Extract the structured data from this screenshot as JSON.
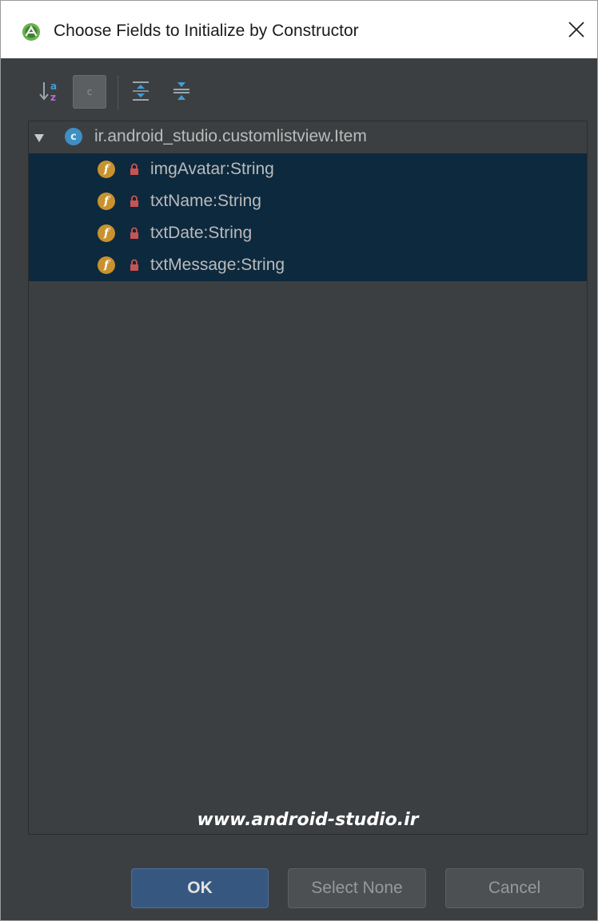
{
  "window": {
    "title": "Choose Fields to Initialize by Constructor",
    "close_label": "✕"
  },
  "toolbar": {
    "buttons": [
      {
        "name": "sort-alphabetically",
        "icon": "sort-az-icon"
      },
      {
        "name": "show-classes",
        "icon": "class-c-icon",
        "label": "c",
        "toggled": true
      },
      {
        "name": "expand-all",
        "icon": "expand-all-icon"
      },
      {
        "name": "collapse-all",
        "icon": "collapse-all-icon"
      }
    ]
  },
  "tree": {
    "root": {
      "icon": "class-icon",
      "icon_letter": "c",
      "label": "ir.android_studio.customlistview.Item",
      "expanded": true
    },
    "fields": [
      {
        "icon_letter": "f",
        "label": "imgAvatar:String",
        "selected": true
      },
      {
        "icon_letter": "f",
        "label": "txtName:String",
        "selected": true
      },
      {
        "icon_letter": "f",
        "label": "txtDate:String",
        "selected": true
      },
      {
        "icon_letter": "f",
        "label": "txtMessage:String",
        "selected": true
      }
    ]
  },
  "watermark": "www.android-studio.ir",
  "buttons": {
    "ok": "OK",
    "select_none": "Select None",
    "cancel": "Cancel"
  },
  "colors": {
    "background": "#3c3f41",
    "selection": "#0d293e",
    "field_icon": "#c8922f",
    "class_icon": "#3d8fc4",
    "lock_icon": "#c75450",
    "ok_button": "#365880"
  }
}
